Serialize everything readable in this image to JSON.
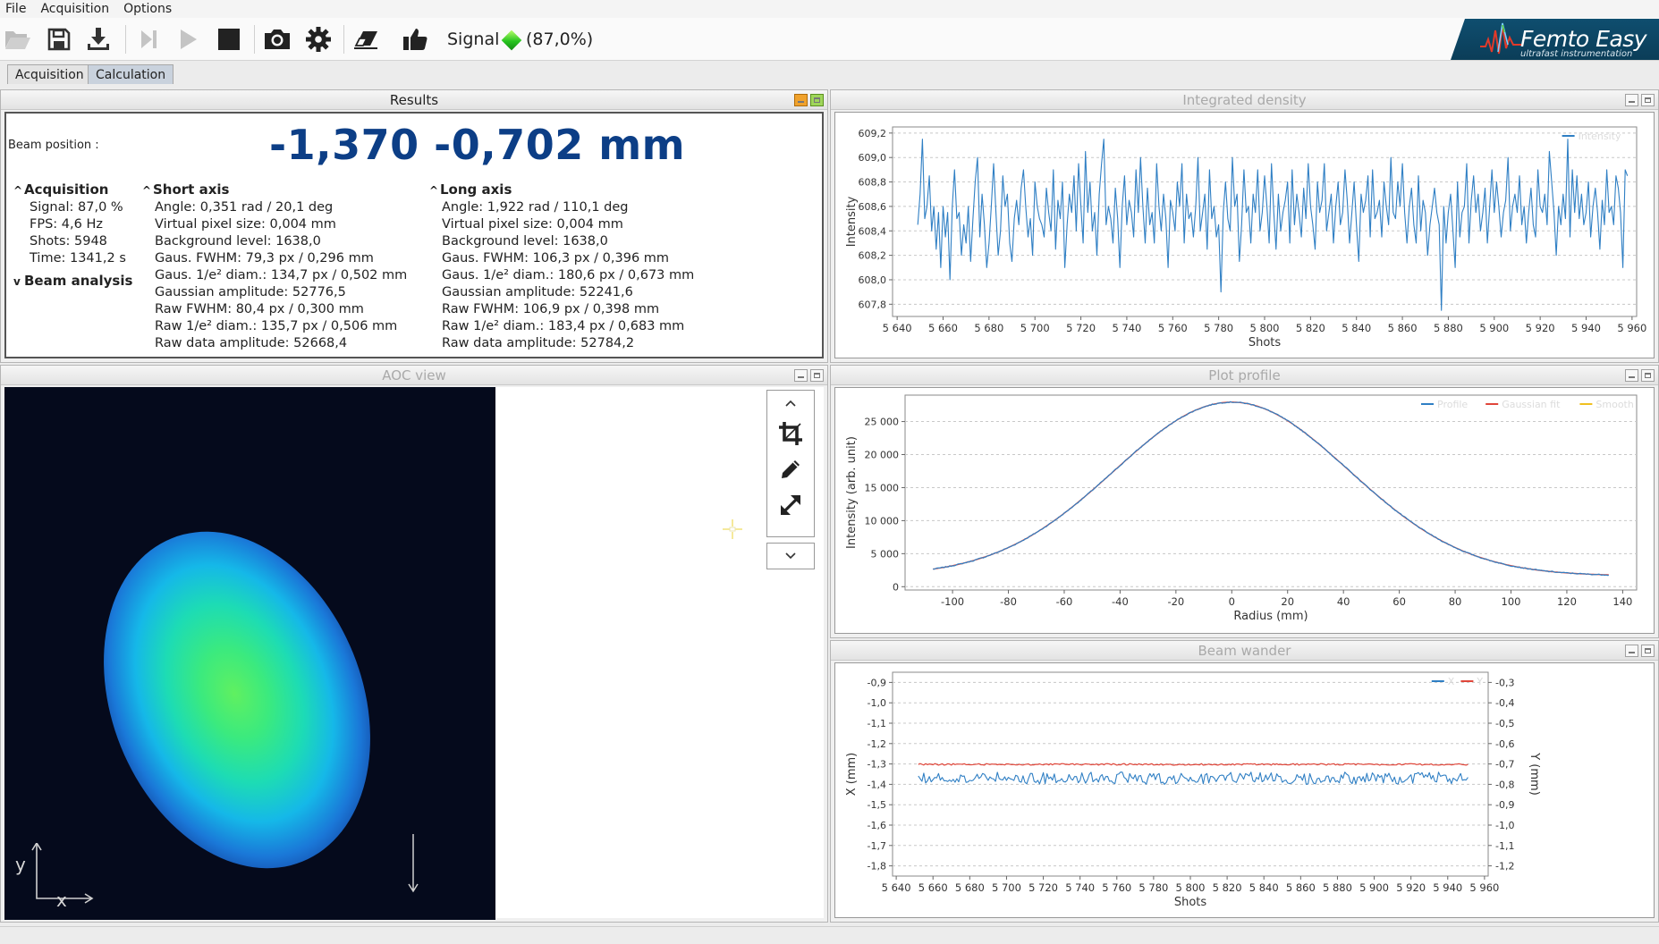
{
  "menu": [
    "File",
    "Acquisition",
    "Options"
  ],
  "toolbar": {
    "icons": [
      "folder-open-icon",
      "save-icon",
      "download-icon",
      "step-icon",
      "play-icon",
      "stop-icon",
      "camera-icon",
      "gear-icon",
      "eraser-icon",
      "thumbs-up-icon"
    ],
    "signal_label": "Signal",
    "signal_value": "(87,0%)",
    "signal_color": "#2ec41f"
  },
  "logo": {
    "name": "Femto Easy",
    "tagline": "ultrafast instrumentation"
  },
  "tabs": [
    {
      "label": "Acquisition",
      "active": false
    },
    {
      "label": "Calculation",
      "active": true
    }
  ],
  "results": {
    "title": "Results",
    "beam_position_label": "Beam position :",
    "beam_position_value": "-1,370 -0,702 mm",
    "acquisition": {
      "title": "Acquisition",
      "items": [
        "Signal: 87,0 %",
        "FPS: 4,6 Hz",
        "Shots: 5948",
        "Time: 1341,2 s"
      ]
    },
    "beam_analysis": {
      "title": "Beam analysis"
    },
    "short_axis": {
      "title": "Short axis",
      "items": [
        "Angle: 0,351 rad / 20,1 deg",
        "Virtual pixel size: 0,004 mm",
        "Background level: 1638,0",
        "Gaus. FWHM: 79,3 px / 0,296 mm",
        "Gaus. 1/e² diam.: 134,7 px / 0,502 mm",
        "Gaussian amplitude: 52776,5",
        "Raw FWHM: 80,4 px / 0,300 mm",
        "Raw 1/e² diam.: 135,7 px / 0,506 mm",
        "Raw data amplitude: 52668,4"
      ]
    },
    "long_axis": {
      "title": "Long axis",
      "items": [
        "Angle: 1,922 rad / 110,1 deg",
        "Virtual pixel size: 0,004 mm",
        "Background level: 1638,0",
        "Gaus. FWHM: 106,3 px / 0,396 mm",
        "Gaus. 1/e² diam.: 180,6 px / 0,673 mm",
        "Gaussian amplitude: 52241,6",
        "Raw FWHM: 106,9 px / 0,398 mm",
        "Raw 1/e² diam.: 183,4 px / 0,683 mm",
        "Raw data amplitude: 52784,2"
      ]
    }
  },
  "aoc": {
    "title": "AOC view",
    "axis_x": "x",
    "axis_y": "y",
    "tools": [
      "chevron-up-icon",
      "crop-icon",
      "pencil-icon",
      "expand-icon",
      "chevron-down-icon"
    ]
  },
  "integrated_density": {
    "title": "Integrated density"
  },
  "plot_profile": {
    "title": "Plot profile"
  },
  "beam_wander": {
    "title": "Beam wander"
  },
  "chart_data": [
    {
      "type": "line",
      "title": "Integrated density",
      "xlabel": "Shots",
      "ylabel": "Intensity",
      "xlim": [
        5638,
        5962
      ],
      "ylim": [
        607.7,
        609.25
      ],
      "xticks": [
        5640,
        5660,
        5680,
        5700,
        5720,
        5740,
        5760,
        5780,
        5800,
        5820,
        5840,
        5860,
        5880,
        5900,
        5920,
        5940,
        5960
      ],
      "yticks": [
        607.8,
        608.0,
        608.2,
        608.4,
        608.6,
        608.8,
        609.0,
        609.2
      ],
      "legend": "top-right",
      "grid": true,
      "series": [
        {
          "name": "Intensity",
          "color": "#2f7fc4",
          "x_start": 5649,
          "x_step": 1,
          "values": [
            608.45,
            608.7,
            609.15,
            608.5,
            608.6,
            608.85,
            608.4,
            608.6,
            608.25,
            608.55,
            608.1,
            608.6,
            608.35,
            608.55,
            608.0,
            608.6,
            608.9,
            608.5,
            608.55,
            608.2,
            608.45,
            608.3,
            608.6,
            608.15,
            608.5,
            608.8,
            609.0,
            608.35,
            608.7,
            608.45,
            608.1,
            608.3,
            608.6,
            608.95,
            608.55,
            608.2,
            608.4,
            608.85,
            608.6,
            608.7,
            608.3,
            608.15,
            608.5,
            608.65,
            608.45,
            608.75,
            608.9,
            608.6,
            608.35,
            608.5,
            608.2,
            608.8,
            608.6,
            608.5,
            608.45,
            608.35,
            608.75,
            608.55,
            608.4,
            608.9,
            608.25,
            608.65,
            608.5,
            608.8,
            608.1,
            608.45,
            608.7,
            608.55,
            608.85,
            608.4,
            608.95,
            608.6,
            608.3,
            609.05,
            608.55,
            608.8,
            608.4,
            608.55,
            608.2,
            608.7,
            608.95,
            609.15,
            608.45,
            608.6,
            608.5,
            608.3,
            608.75,
            608.5,
            608.1,
            608.6,
            608.85,
            608.45,
            608.65,
            608.55,
            608.35,
            608.9,
            608.55,
            609.0,
            608.6,
            608.3,
            608.75,
            608.45,
            608.55,
            608.3,
            608.95,
            608.6,
            608.4,
            608.7,
            608.5,
            608.1,
            608.65,
            608.55,
            608.4,
            608.8,
            608.6,
            608.95,
            608.3,
            608.7,
            608.5,
            608.55,
            608.35,
            608.6,
            609.0,
            608.4,
            608.55,
            608.7,
            608.25,
            608.9,
            608.5,
            608.6,
            608.35,
            608.45,
            607.9,
            608.55,
            608.8,
            608.5,
            608.4,
            609.0,
            608.6,
            608.7,
            608.15,
            608.45,
            608.9,
            608.55,
            608.6,
            608.3,
            608.7,
            608.55,
            608.9,
            608.4,
            608.55,
            608.85,
            608.6,
            608.3,
            608.95,
            608.55,
            608.25,
            608.7,
            608.4,
            608.55,
            608.65,
            608.8,
            608.3,
            608.9,
            608.45,
            608.7,
            608.55,
            608.35,
            608.75,
            608.5,
            608.95,
            608.6,
            608.45,
            608.25,
            608.8,
            608.55,
            608.65,
            608.95,
            608.4,
            608.55,
            608.7,
            608.3,
            608.6,
            608.8,
            608.45,
            608.55,
            608.9,
            608.65,
            608.3,
            608.55,
            608.8,
            608.45,
            608.15,
            608.7,
            608.55,
            608.65,
            608.85,
            608.35,
            608.9,
            608.5,
            608.55,
            608.65,
            608.35,
            608.8,
            608.6,
            608.45,
            609.0,
            608.55,
            608.5,
            608.8,
            608.6,
            608.95,
            608.55,
            608.3,
            608.6,
            608.75,
            608.45,
            608.3,
            608.85,
            608.4,
            608.65,
            608.55,
            608.2,
            608.45,
            608.6,
            608.75,
            608.55,
            608.45,
            607.75,
            608.6,
            608.3,
            608.55,
            608.7,
            608.4,
            608.1,
            608.8,
            608.35,
            608.55,
            608.6,
            608.95,
            608.3,
            608.65,
            608.85,
            608.55,
            608.7,
            608.4,
            608.55,
            608.75,
            608.3,
            608.6,
            608.9,
            608.55,
            608.8,
            608.6,
            608.35,
            608.55,
            608.65,
            609.0,
            608.4,
            608.6,
            608.7,
            608.55,
            608.85,
            608.45,
            608.6,
            608.3,
            608.55,
            608.75,
            608.45,
            608.35,
            608.9,
            608.6,
            608.55,
            608.7,
            608.45,
            609.05,
            608.8,
            608.55,
            608.2,
            608.6,
            608.45,
            608.7,
            608.5,
            609.15,
            608.35,
            608.9,
            608.55,
            608.85,
            608.5,
            608.7,
            608.45,
            608.55,
            608.8,
            608.35,
            608.6,
            608.75,
            608.55,
            608.25,
            608.65,
            608.45,
            608.9,
            608.55,
            608.6,
            608.45,
            608.85,
            608.75,
            608.55,
            608.1,
            608.9,
            608.85
          ]
        }
      ]
    },
    {
      "type": "line",
      "title": "Plot profile",
      "xlabel": "Radius (mm)",
      "ylabel": "Intensity (arb. unit)",
      "xlim": [
        -117,
        145
      ],
      "ylim": [
        -500,
        29000
      ],
      "xticks": [
        -100,
        -80,
        -60,
        -40,
        -20,
        0,
        20,
        40,
        60,
        80,
        100,
        120,
        140
      ],
      "yticks": [
        0,
        5000,
        10000,
        15000,
        20000,
        25000
      ],
      "ytick_labels": [
        "0",
        "5 000",
        "10 000",
        "15 000",
        "20 000",
        "25 000"
      ],
      "legend": "top-right",
      "grid": true,
      "gauss": {
        "amplitude": 26300,
        "offset": 1640,
        "center": 0,
        "sigma": 42,
        "x_range": [
          -107,
          135
        ]
      },
      "series": [
        {
          "name": "Profile",
          "color": "#2f7fc4"
        },
        {
          "name": "Gaussian fit",
          "color": "#e0463a"
        },
        {
          "name": "Smooth",
          "color": "#f0c020"
        }
      ]
    },
    {
      "type": "line",
      "title": "Beam wander",
      "xlabel": "Shots",
      "ylabel": "X (mm)",
      "ylabel2": "Y (mm)",
      "xlim": [
        5638,
        5962
      ],
      "ylim": [
        -1.85,
        -0.85
      ],
      "ylim2": [
        -1.25,
        -0.25
      ],
      "xticks": [
        5640,
        5660,
        5680,
        5700,
        5720,
        5740,
        5760,
        5780,
        5800,
        5820,
        5840,
        5860,
        5880,
        5900,
        5920,
        5940,
        5960
      ],
      "yticks": [
        -0.9,
        -1.0,
        -1.1,
        -1.2,
        -1.3,
        -1.4,
        -1.5,
        -1.6,
        -1.7,
        -1.8
      ],
      "yticks2": [
        -0.3,
        -0.4,
        -0.5,
        -0.6,
        -0.7,
        -0.8,
        -0.9,
        -1.0,
        -1.1,
        -1.2
      ],
      "legend": "top-right",
      "grid": true,
      "series": [
        {
          "name": "X",
          "color": "#2f7fc4",
          "mean": -1.37,
          "noise": 0.03,
          "x_range": [
            5652,
            5951
          ]
        },
        {
          "name": "Y",
          "color": "#e0463a",
          "mean": -0.702,
          "noise": 0.004,
          "x_range": [
            5652,
            5951
          ]
        }
      ]
    }
  ]
}
